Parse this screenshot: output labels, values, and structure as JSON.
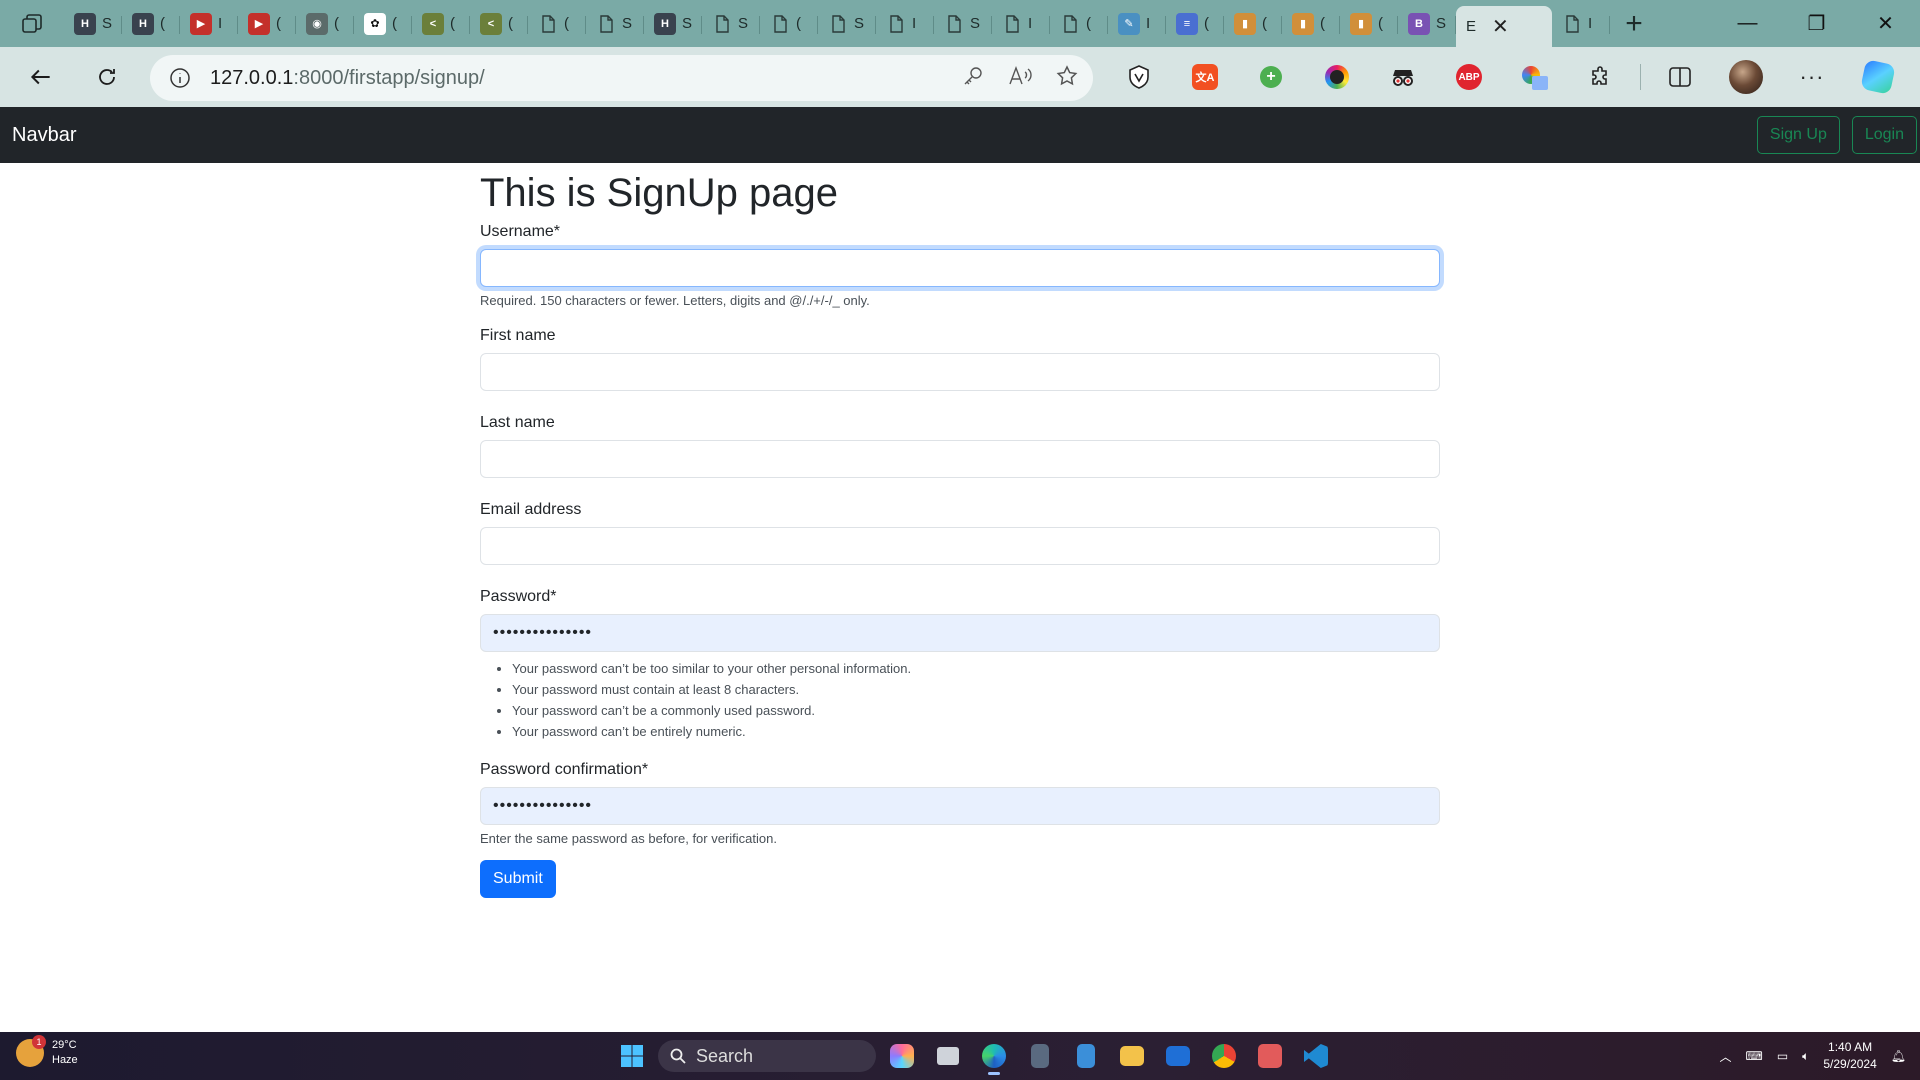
{
  "browser": {
    "tabs": [
      {
        "icon": "hackerrank-icon",
        "label": "S",
        "color": "#39424e",
        "glyph": "H"
      },
      {
        "icon": "hackerrank-icon",
        "label": "(",
        "color": "#39424e",
        "glyph": "H"
      },
      {
        "icon": "youtube-icon",
        "label": "I",
        "color": "#c4302b",
        "glyph": "▶"
      },
      {
        "icon": "youtube-icon",
        "label": "(",
        "color": "#c4302b",
        "glyph": "▶"
      },
      {
        "icon": "github-icon",
        "label": "(",
        "color": "#5b6b6a",
        "glyph": "◉"
      },
      {
        "icon": "chatgpt-icon",
        "label": "(",
        "color": "#ffffff",
        "glyph": "✿"
      },
      {
        "icon": "code-icon",
        "label": "(",
        "color": "#6b7f3a",
        "glyph": "<"
      },
      {
        "icon": "code-icon",
        "label": "(",
        "color": "#6b7f3a",
        "glyph": "<"
      },
      {
        "icon": "page-icon",
        "label": "(",
        "color": "none",
        "glyph": ""
      },
      {
        "icon": "page-icon",
        "label": "S",
        "color": "none",
        "glyph": ""
      },
      {
        "icon": "hackerrank-icon",
        "label": "S",
        "color": "#39424e",
        "glyph": "H"
      },
      {
        "icon": "page-icon",
        "label": "S",
        "color": "none",
        "glyph": ""
      },
      {
        "icon": "page-icon",
        "label": "(",
        "color": "none",
        "glyph": ""
      },
      {
        "icon": "page-icon",
        "label": "S",
        "color": "none",
        "glyph": ""
      },
      {
        "icon": "page-icon",
        "label": "I",
        "color": "none",
        "glyph": ""
      },
      {
        "icon": "page-icon",
        "label": "S",
        "color": "none",
        "glyph": ""
      },
      {
        "icon": "page-icon",
        "label": "I",
        "color": "none",
        "glyph": ""
      },
      {
        "icon": "page-icon",
        "label": "(",
        "color": "none",
        "glyph": ""
      },
      {
        "icon": "feather-icon",
        "label": "I",
        "color": "#4a90c2",
        "glyph": "✎"
      },
      {
        "icon": "docs-icon",
        "label": "(",
        "color": "#4a6fd1",
        "glyph": "≡"
      },
      {
        "icon": "chart-icon",
        "label": "(",
        "color": "#d18f3a",
        "glyph": "▮"
      },
      {
        "icon": "chart-icon",
        "label": "(",
        "color": "#d18f3a",
        "glyph": "▮"
      },
      {
        "icon": "chart-icon",
        "label": "(",
        "color": "#d18f3a",
        "glyph": "▮"
      },
      {
        "icon": "bootstrap-icon",
        "label": "S",
        "color": "#7952b3",
        "glyph": "B"
      }
    ],
    "active_tab": {
      "label": "E"
    },
    "trailing_tab": {
      "label": "I"
    },
    "url_host": "127.0.0.1",
    "url_path": ":8000/firstapp/signup/"
  },
  "navbar": {
    "brand": "Navbar",
    "signup_label": "Sign Up",
    "login_label": "Login"
  },
  "form": {
    "title": "This is SignUp page",
    "username": {
      "label": "Username*",
      "value": "",
      "help": "Required. 150 characters or fewer. Letters, digits and @/./+/-/_ only."
    },
    "first_name": {
      "label": "First name",
      "value": ""
    },
    "last_name": {
      "label": "Last name",
      "value": ""
    },
    "email": {
      "label": "Email address",
      "value": ""
    },
    "password": {
      "label": "Password*",
      "value": "•••••••••••••••",
      "rules": [
        "Your password can’t be too similar to your other personal information.",
        "Your password must contain at least 8 characters.",
        "Your password can’t be a commonly used password.",
        "Your password can’t be entirely numeric."
      ]
    },
    "password_confirm": {
      "label": "Password confirmation*",
      "value": "•••••••••••••••",
      "help": "Enter the same password as before, for verification."
    },
    "submit_label": "Submit"
  },
  "taskbar": {
    "weather_temp": "29°C",
    "weather_desc": "Haze",
    "weather_badge": "1",
    "search_label": "Search",
    "time": "1:40 AM",
    "date": "5/29/2024"
  }
}
